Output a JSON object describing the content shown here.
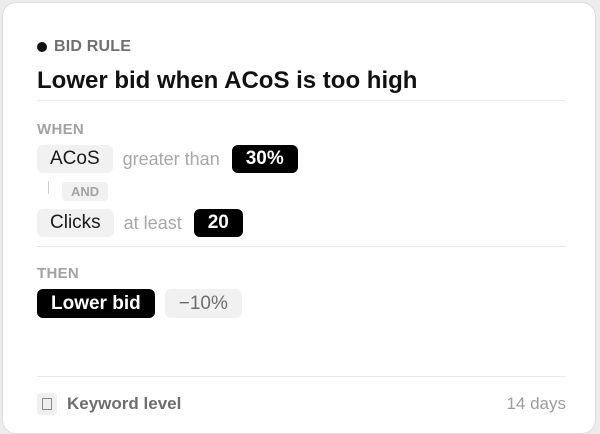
{
  "rule": {
    "eyebrow": "BID RULE",
    "title": "Lower bid when ACoS is too high"
  },
  "when": {
    "label": "WHEN",
    "conditions": [
      {
        "metric": "ACoS",
        "operator": "greater than",
        "value": "30%"
      },
      {
        "metric": "Clicks",
        "operator": "at least",
        "value": "20"
      }
    ],
    "joiner": "AND"
  },
  "then": {
    "label": "THEN",
    "action": "Lower bid",
    "amount": "−10%"
  },
  "footer": {
    "level": "Keyword level",
    "window": "14 days"
  }
}
